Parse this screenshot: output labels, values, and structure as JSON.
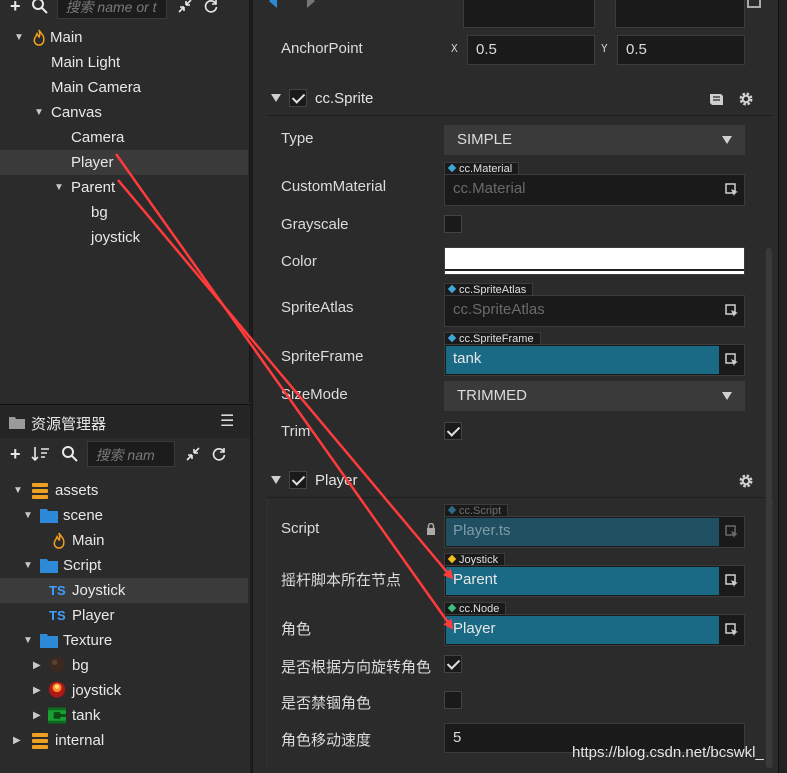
{
  "hierarchy": {
    "search_placeholder": "搜索 name or t",
    "nodes": [
      {
        "label": "Main",
        "depth": 0,
        "expanded": true,
        "icon": "scene-flame-icon"
      },
      {
        "label": "Main Light",
        "depth": 1
      },
      {
        "label": "Main Camera",
        "depth": 1
      },
      {
        "label": "Canvas",
        "depth": 1,
        "expanded": true
      },
      {
        "label": "Camera",
        "depth": 2
      },
      {
        "label": "Player",
        "depth": 2,
        "selected": true
      },
      {
        "label": "Parent",
        "depth": 2,
        "expanded": true
      },
      {
        "label": "bg",
        "depth": 3
      },
      {
        "label": "joystick",
        "depth": 3
      }
    ]
  },
  "assets": {
    "title": "资源管理器",
    "menu_icon": "hamburger-menu-icon",
    "search_placeholder": "搜索 nam",
    "items": [
      {
        "label": "assets",
        "icon": "db-icon"
      },
      {
        "label": "scene",
        "icon": "folder-icon"
      },
      {
        "label": "Main",
        "icon": "scene-flame-icon"
      },
      {
        "label": "Script",
        "icon": "folder-icon"
      },
      {
        "label": "Joystick",
        "icon": "ts-icon",
        "badge": "TS"
      },
      {
        "label": "Player",
        "icon": "ts-icon",
        "badge": "TS"
      },
      {
        "label": "Texture",
        "icon": "folder-icon"
      },
      {
        "label": "bg",
        "icon": "texture-dark-icon"
      },
      {
        "label": "joystick",
        "icon": "texture-red-icon"
      },
      {
        "label": "tank",
        "icon": "texture-tank-icon"
      },
      {
        "label": "internal",
        "icon": "db-icon"
      }
    ]
  },
  "inspector": {
    "anchor": {
      "label": "AnchorPoint",
      "x_axis": "X",
      "x_value": "0.5",
      "y_axis": "Y",
      "y_value": "0.5"
    },
    "sprite": {
      "title": "cc.Sprite",
      "enabled": true,
      "type_label": "Type",
      "type_value": "SIMPLE",
      "custom_material_label": "CustomMaterial",
      "custom_material_tag": "cc.Material",
      "custom_material_value": "cc.Material",
      "grayscale_label": "Grayscale",
      "color_label": "Color",
      "color_value": "#ffffff",
      "atlas_label": "SpriteAtlas",
      "atlas_tag": "cc.SpriteAtlas",
      "atlas_value": "cc.SpriteAtlas",
      "frame_label": "SpriteFrame",
      "frame_tag": "cc.SpriteFrame",
      "frame_value": "tank",
      "size_mode_label": "SizeMode",
      "size_mode_value": "TRIMMED",
      "trim_label": "Trim"
    },
    "player": {
      "title": "Player",
      "enabled": true,
      "script_label": "Script",
      "script_tag": "cc.Script",
      "script_value": "Player.ts",
      "joystick_node_label": "摇杆脚本所在节点",
      "joystick_node_tag": "Joystick",
      "joystick_node_value": "Parent",
      "role_label": "角色",
      "role_tag": "cc.Node",
      "role_value": "Player",
      "rotate_label": "是否根据方向旋转角色",
      "ban_label": "是否禁锢角色",
      "speed_label": "角色移动速度",
      "speed_value": "5"
    }
  },
  "watermark": "https://blog.csdn.net/bcswkl_",
  "colors": {
    "accent": "#1a6985",
    "arrow": "#ff3b3b",
    "panel": "#2b2b2b"
  }
}
